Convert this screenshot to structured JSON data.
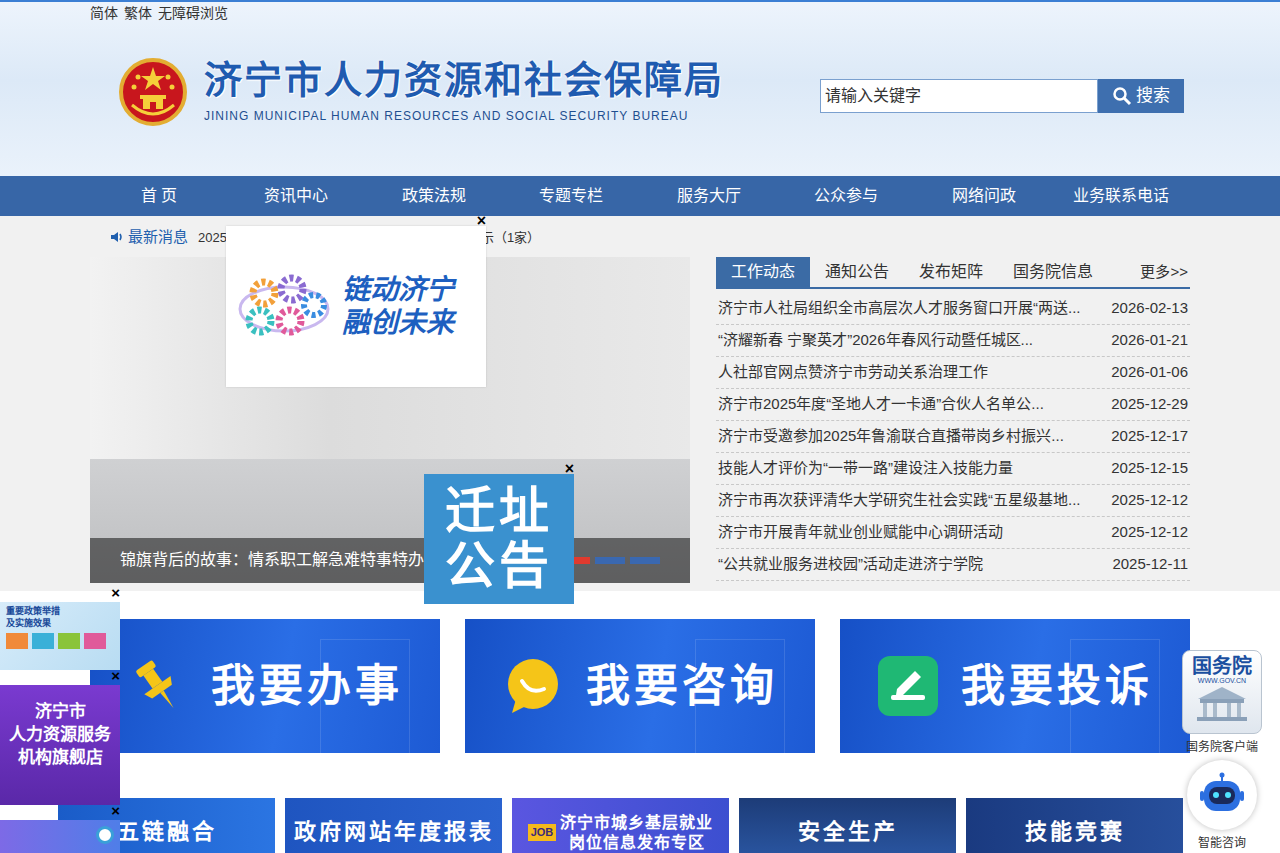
{
  "top_links": [
    "简体",
    "繁体",
    "无障碍浏览"
  ],
  "site": {
    "title": "济宁市人力资源和社会保障局",
    "subtitle": "JINING MUNICIPAL HUMAN RESOURCES AND SOCIAL SECURITY BUREAU"
  },
  "search": {
    "placeholder": "请输入关键字",
    "button": "搜索"
  },
  "nav": [
    "首 页",
    "资讯中心",
    "政策法规",
    "专题专栏",
    "服务大厅",
    "公众参与",
    "网络问政",
    "业务联系电话"
  ],
  "ticker": {
    "label": "最新消息",
    "start": "2025",
    "end": "示（1家）"
  },
  "carousel": {
    "caption": "锦旗背后的故事：情系职工解急难特事特办显",
    "dots": [
      {
        "selected": true
      },
      {
        "selected": false
      },
      {
        "selected": false
      }
    ]
  },
  "news_tabs": [
    {
      "label": "工作动态",
      "selected": true
    },
    {
      "label": "通知公告",
      "selected": false
    },
    {
      "label": "发布矩阵",
      "selected": false
    },
    {
      "label": "国务院信息",
      "selected": false
    }
  ],
  "news_more": "更多>>",
  "news": [
    {
      "title": "济宁市人社局组织全市高层次人才服务窗口开展“两送...",
      "date": "2026-02-13"
    },
    {
      "title": "“济耀新春 宁聚英才”2026年春风行动暨任城区...",
      "date": "2026-01-21"
    },
    {
      "title": "人社部官网点赞济宁市劳动关系治理工作",
      "date": "2026-01-06"
    },
    {
      "title": "济宁市2025年度“圣地人才一卡通”合伙人名单公...",
      "date": "2025-12-29"
    },
    {
      "title": "济宁市受邀参加2025年鲁渝联合直播带岗乡村振兴...",
      "date": "2025-12-17"
    },
    {
      "title": "技能人才评价为“一带一路”建设注入技能力量",
      "date": "2025-12-15"
    },
    {
      "title": "济宁市再次获评清华大学研究生社会实践“五星级基地...",
      "date": "2025-12-12"
    },
    {
      "title": "济宁市开展青年就业创业赋能中心调研活动",
      "date": "2025-12-12"
    },
    {
      "title": "“公共就业服务进校园”活动走进济宁学院",
      "date": "2025-12-11"
    }
  ],
  "quick": [
    {
      "label": "我要办事",
      "kind": "pin"
    },
    {
      "label": "我要咨询",
      "kind": "chat"
    },
    {
      "label": "我要投诉",
      "kind": "complaint"
    }
  ],
  "tiles": [
    {
      "lines": [
        "五链融合"
      ]
    },
    {
      "lines": [
        "政府网站年度报表"
      ]
    },
    {
      "lines": [
        "济宁市城乡基层就业",
        "岗位信息发布专区"
      ],
      "tag": "JOB"
    },
    {
      "lines": [
        "安全生产"
      ]
    },
    {
      "lines": [
        "技能竞赛"
      ]
    }
  ],
  "left_ads": [
    {
      "kind": "policy",
      "lines": [
        "重要政策举措",
        "及实施效果"
      ],
      "close": "×"
    },
    {
      "kind": "shop",
      "lines": [
        "济宁市",
        "人力资源服务",
        "机构旗舰店"
      ],
      "close": "×"
    },
    {
      "kind": "banner",
      "lines": [],
      "close": "×"
    }
  ],
  "gov_app": {
    "logo": "国务院",
    "url": "WWW.GOV.CN",
    "label": "国务院客户端"
  },
  "robot": {
    "label": "智能咨询"
  },
  "popup": {
    "lines": [
      "链动济宁",
      "融创未来"
    ],
    "close": "×"
  },
  "relocation": {
    "lines": [
      "迁址",
      "公告"
    ],
    "close": "×"
  }
}
